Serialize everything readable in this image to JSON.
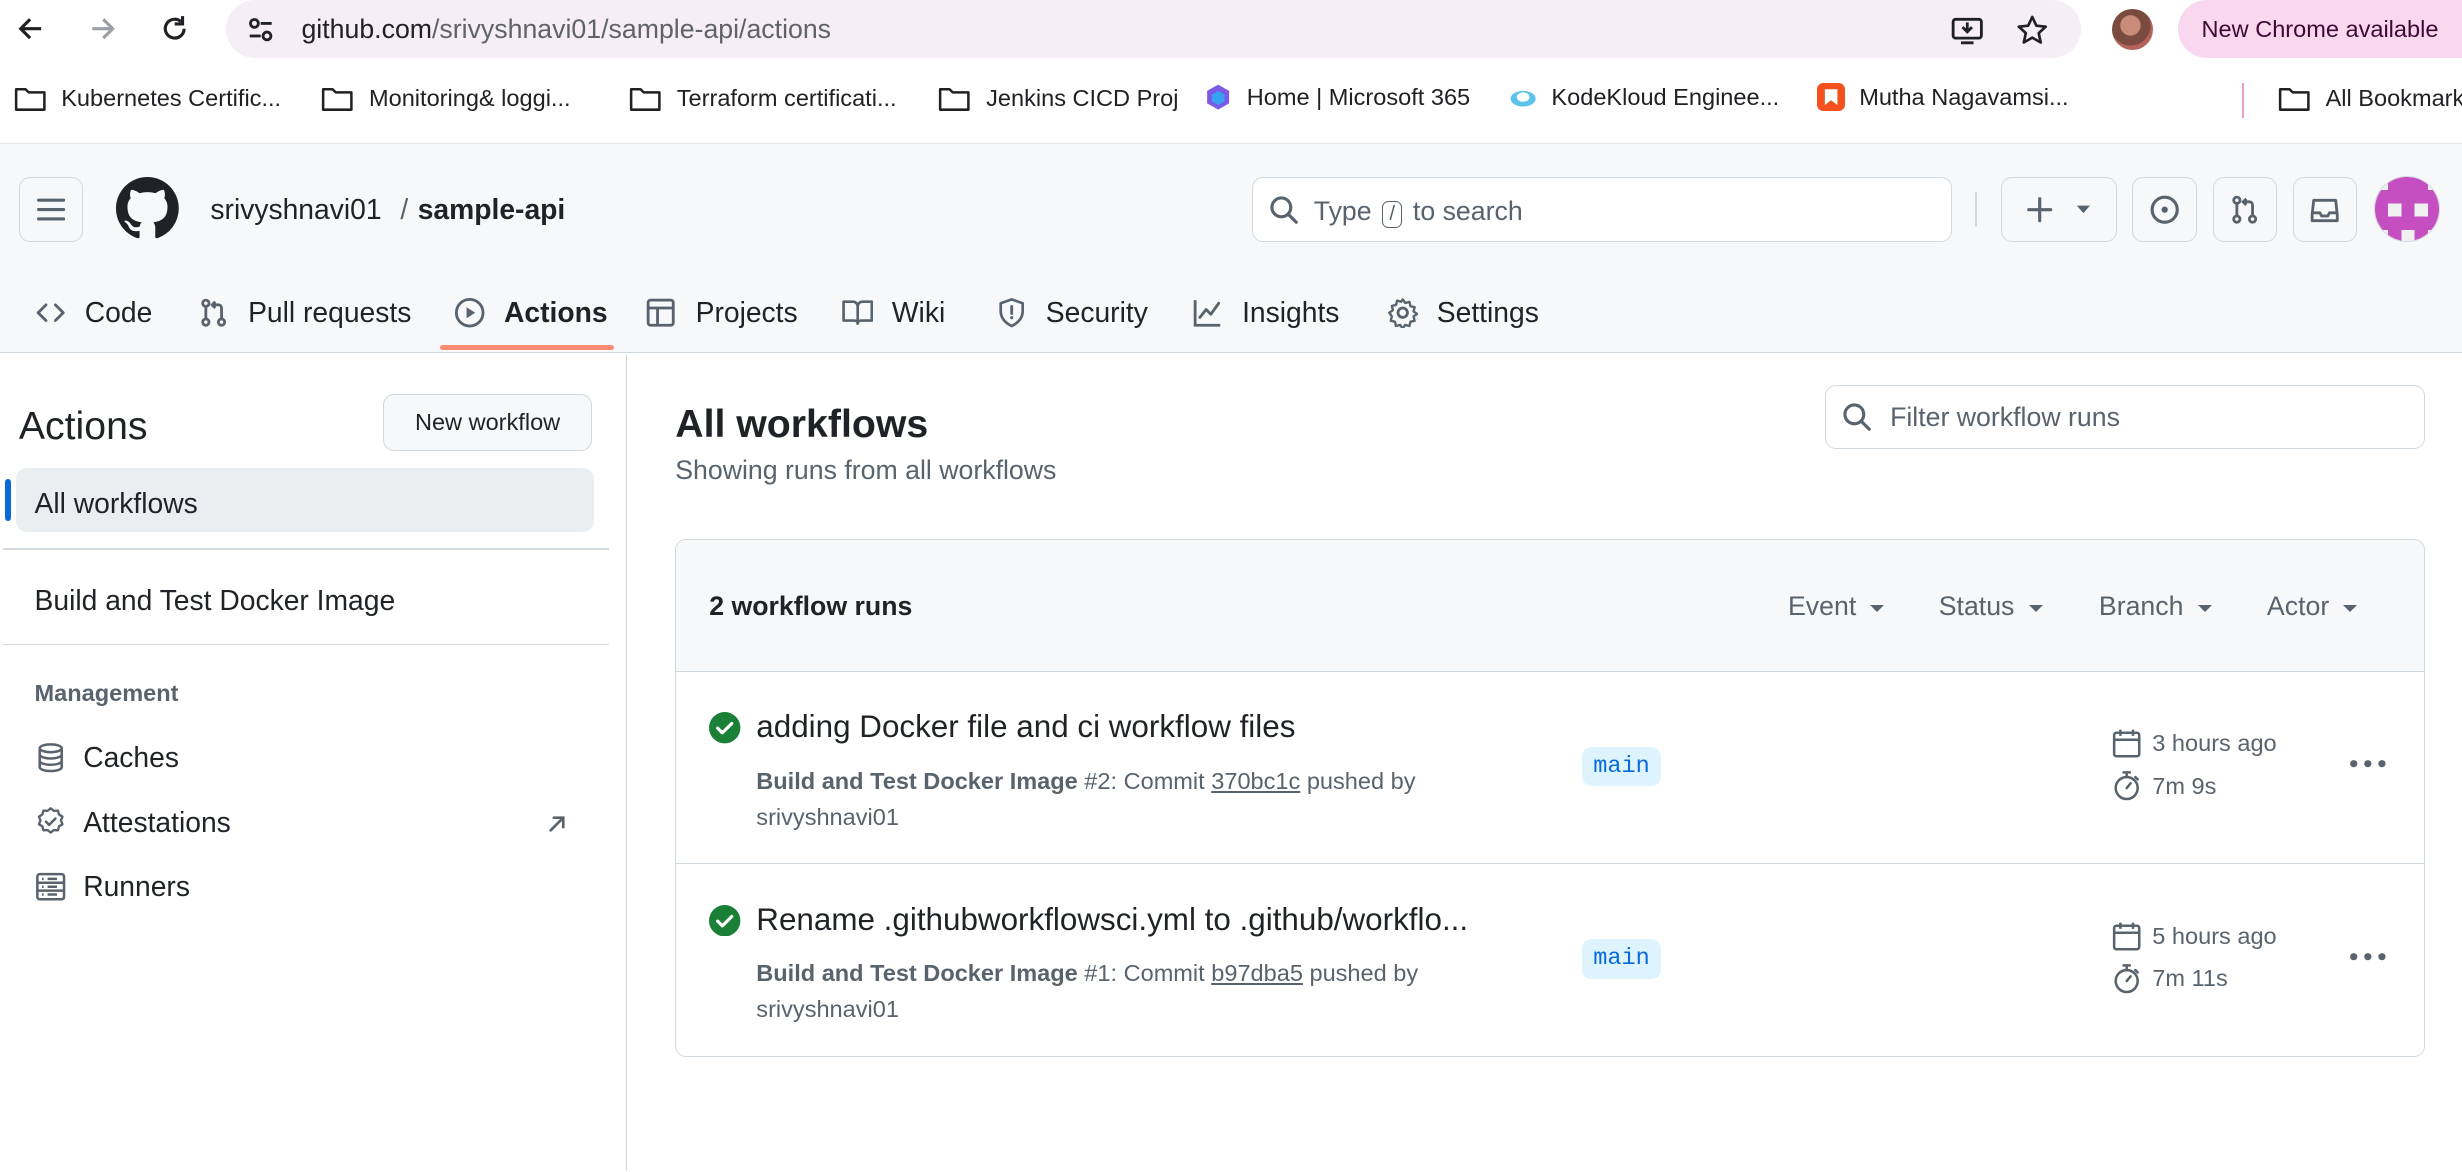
{
  "browser": {
    "url_host": "github.com",
    "url_path": "/srivyshnavi01/sample-api/actions",
    "update_pill": "New Chrome available"
  },
  "bookmarks": [
    {
      "label": "Kubernetes Certific...",
      "icon": "folder-icon"
    },
    {
      "label": "Monitoring& loggi...",
      "icon": "folder-icon"
    },
    {
      "label": "Terraform certificati...",
      "icon": "folder-icon"
    },
    {
      "label": "Jenkins CICD Proj",
      "icon": "folder-icon"
    },
    {
      "label": "Home | Microsoft 365",
      "icon": "microsoft-365-icon"
    },
    {
      "label": "KodeKloud Enginee...",
      "icon": "kodekloud-icon"
    },
    {
      "label": "Mutha Nagavamsi...",
      "icon": "bookmark-site-icon"
    },
    {
      "label": "All Bookmarks",
      "icon": "folder-icon"
    }
  ],
  "header": {
    "owner": "srivyshnavi01",
    "separator": "/",
    "repo": "sample-api",
    "search": {
      "prefix": "Type",
      "key": "/",
      "suffix": "to search"
    }
  },
  "tabs": [
    {
      "label": "Code",
      "icon": "code-icon"
    },
    {
      "label": "Pull requests",
      "icon": "pull-request-icon"
    },
    {
      "label": "Actions",
      "icon": "play-icon",
      "active": true
    },
    {
      "label": "Projects",
      "icon": "table-icon"
    },
    {
      "label": "Wiki",
      "icon": "book-icon"
    },
    {
      "label": "Security",
      "icon": "shield-icon"
    },
    {
      "label": "Insights",
      "icon": "graph-icon"
    },
    {
      "label": "Settings",
      "icon": "gear-icon"
    }
  ],
  "sidebar": {
    "title": "Actions",
    "new_workflow": "New workflow",
    "all_workflows": "All workflows",
    "workflows": [
      "Build and Test Docker Image"
    ],
    "management_heading": "Management",
    "management": [
      {
        "label": "Caches",
        "icon": "database-icon"
      },
      {
        "label": "Attestations",
        "icon": "verified-icon"
      },
      {
        "label": "Runners",
        "icon": "server-icon"
      }
    ]
  },
  "main": {
    "title": "All workflows",
    "subtitle": "Showing runs from all workflows",
    "filter_placeholder": "Filter workflow runs",
    "runs_count": "2 workflow runs",
    "filters": [
      "Event",
      "Status",
      "Branch",
      "Actor"
    ],
    "runs": [
      {
        "title": "adding Docker file and ci workflow files",
        "workflow": "Build and Test Docker Image",
        "number": "#2",
        "commit_label": "Commit",
        "sha": "370bc1c",
        "pushed": "pushed by",
        "actor": "srivyshnavi01",
        "branch": "main",
        "when": "3 hours ago",
        "duration": "7m 9s",
        "status": "success"
      },
      {
        "title": "Rename .githubworkflowsci.yml to .github/workflo...",
        "workflow": "Build and Test Docker Image",
        "number": "#1",
        "commit_label": "Commit",
        "sha": "b97dba5",
        "pushed": "pushed by",
        "actor": "srivyshnavi01",
        "branch": "main",
        "when": "5 hours ago",
        "duration": "7m 11s",
        "status": "success"
      }
    ]
  },
  "colors": {
    "success": "#1a7f37",
    "accent_blue": "#0969da",
    "tab_underline": "#fd8c73"
  }
}
